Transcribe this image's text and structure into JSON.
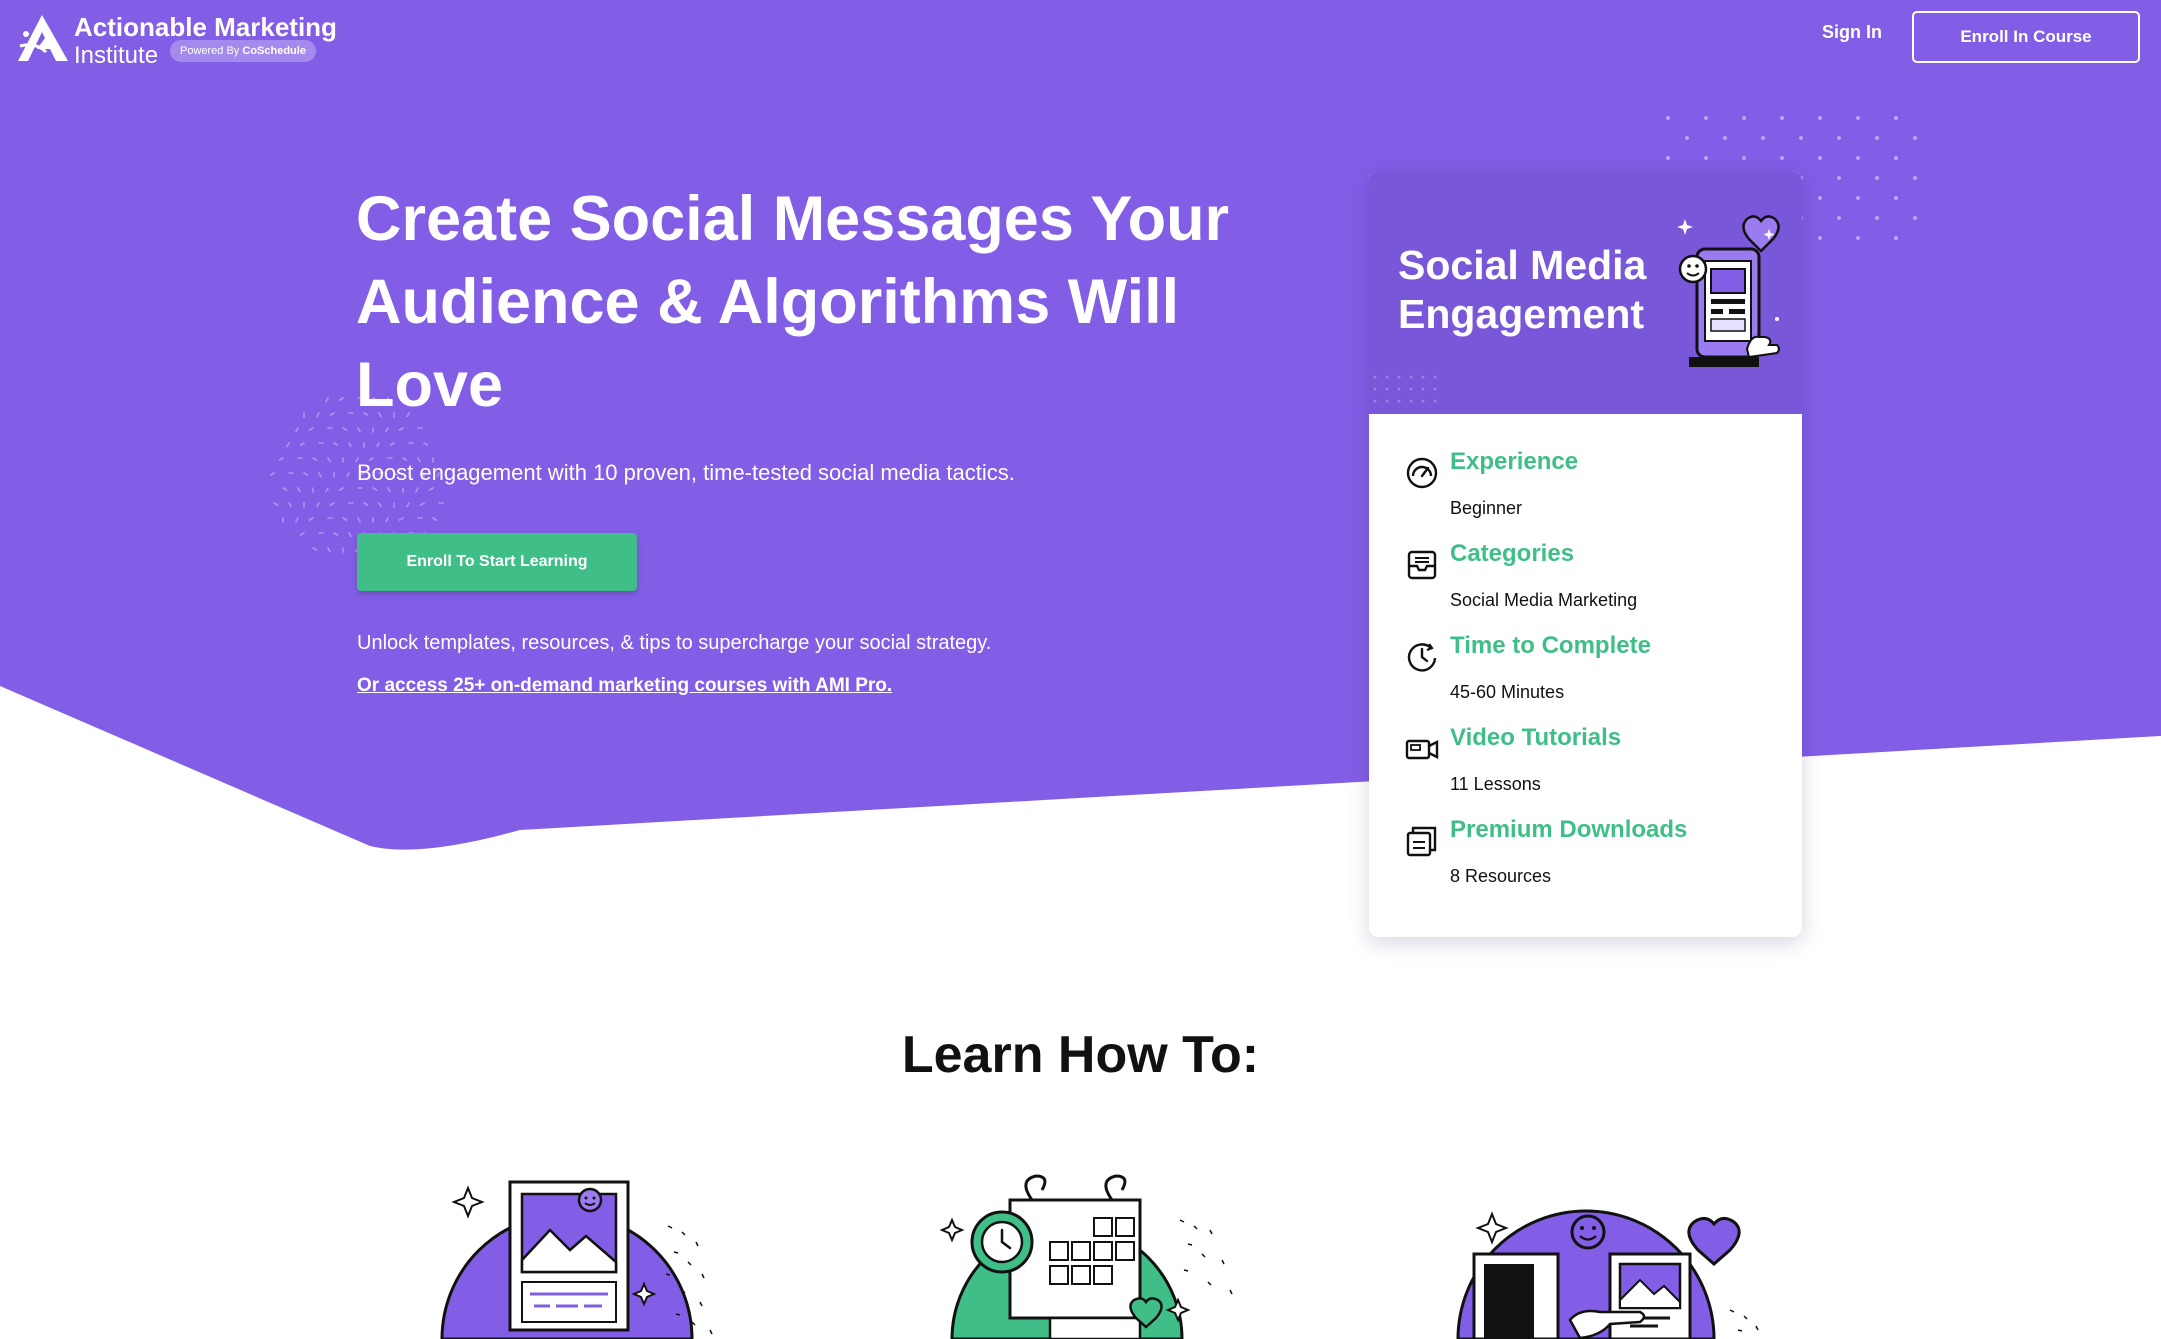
{
  "colors": {
    "brand_purple": "#825ee6",
    "card_purple": "#7857d8",
    "accent_green": "#3fbf87",
    "white": "#ffffff",
    "text_dark": "#111111"
  },
  "header": {
    "logo": {
      "line1": "Actionable Marketing",
      "line2": "Institute",
      "powered_prefix": "Powered By",
      "powered_brand": "CoSchedule",
      "icon": "ami-logo-icon"
    },
    "sign_in_label": "Sign In",
    "enroll_label": "Enroll In Course"
  },
  "hero": {
    "title": "Create Social Messages Your Audience & Algorithms Will Love",
    "subtitle": "Boost engagement with 10 proven, time-tested social media tactics.",
    "cta_label": "Enroll To Start Learning",
    "unlock_text": "Unlock templates, resources, & tips to supercharge your social strategy.",
    "pro_link_text": "Or access 25+ on-demand marketing courses with AMI Pro."
  },
  "course_card": {
    "title": "Social Media Engagement",
    "items": [
      {
        "label": "Experience",
        "value": "Beginner",
        "icon": "gauge-icon"
      },
      {
        "label": "Categories",
        "value": "Social Media Marketing",
        "icon": "inbox-tray-icon"
      },
      {
        "label": "Time to Complete",
        "value": "45-60 Minutes",
        "icon": "clock-icon"
      },
      {
        "label": "Video Tutorials",
        "value": "11 Lessons",
        "icon": "video-camera-icon"
      },
      {
        "label": "Premium Downloads",
        "value": "8 Resources",
        "icon": "downloads-icon"
      }
    ]
  },
  "learn_section": {
    "title": "Learn How To:",
    "illustrations": [
      "social-post-illustration",
      "calendar-illustration",
      "engagement-illustration"
    ]
  }
}
